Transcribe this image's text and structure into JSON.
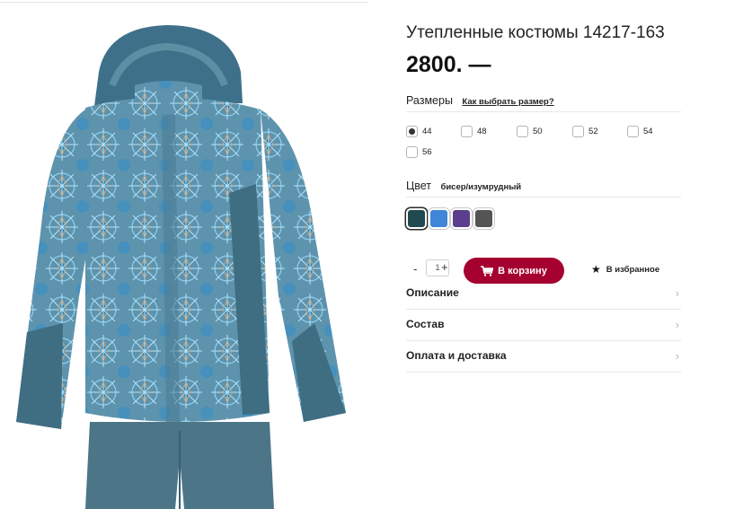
{
  "product": {
    "title": "Утепленные костюмы 14217-163",
    "price": "2800. —",
    "image_icon": "jacket-photo"
  },
  "sizes": {
    "label": "Размеры",
    "guide_link": "Как выбрать размер?",
    "options": [
      {
        "label": "44",
        "checked": true
      },
      {
        "label": "48",
        "checked": false
      },
      {
        "label": "50",
        "checked": false
      },
      {
        "label": "52",
        "checked": false
      },
      {
        "label": "54",
        "checked": false
      },
      {
        "label": "56",
        "checked": false
      }
    ]
  },
  "color": {
    "label": "Цвет",
    "selected_name": "бисер/изумрудный",
    "swatches": [
      {
        "color": "#1f4a50",
        "selected": true
      },
      {
        "color": "#3f86d8",
        "selected": false
      },
      {
        "color": "#5b3f8c",
        "selected": false
      },
      {
        "color": "#545454",
        "selected": false
      }
    ]
  },
  "buy": {
    "minus": "-",
    "quantity": "1",
    "plus": "+",
    "cart_label": "В корзину",
    "cart_color": "#a5002f",
    "favorite_label": "В избранное",
    "favorite_icon": "star-icon"
  },
  "accordion": [
    {
      "label": "Описание"
    },
    {
      "label": "Состав"
    },
    {
      "label": "Оплата и доставка"
    }
  ]
}
